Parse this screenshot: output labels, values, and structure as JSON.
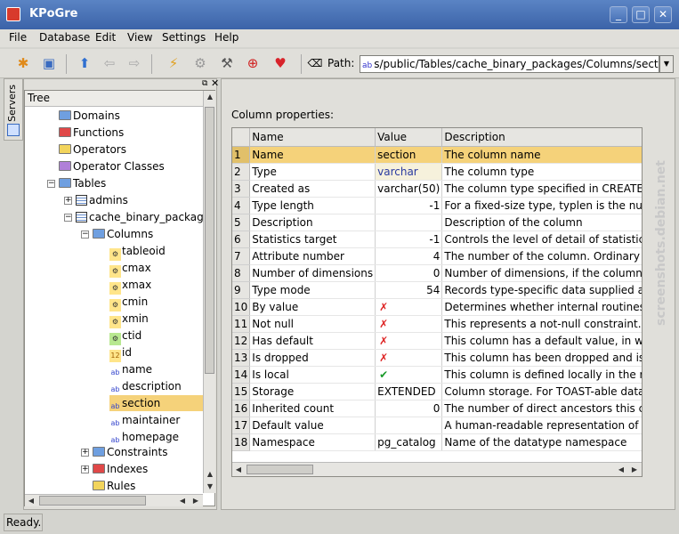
{
  "window": {
    "title": "KPoGre"
  },
  "menu": [
    "File",
    "Database",
    "Edit",
    "View",
    "Settings",
    "Help"
  ],
  "toolbar": {
    "path_label": "Path:",
    "path_value": "s/public/Tables/cache_binary_packages/Columns/section"
  },
  "sidebar_tab": "Servers",
  "tree": {
    "header": "Tree",
    "items": [
      {
        "label": "Domains"
      },
      {
        "label": "Functions"
      },
      {
        "label": "Operators"
      },
      {
        "label": "Operator Classes"
      },
      {
        "label": "Tables"
      },
      {
        "label": "admins"
      },
      {
        "label": "cache_binary_package"
      },
      {
        "label": "Columns"
      },
      {
        "label": "tableoid"
      },
      {
        "label": "cmax"
      },
      {
        "label": "xmax"
      },
      {
        "label": "cmin"
      },
      {
        "label": "xmin"
      },
      {
        "label": "ctid"
      },
      {
        "label": "id"
      },
      {
        "label": "name"
      },
      {
        "label": "description"
      },
      {
        "label": "section"
      },
      {
        "label": "maintainer"
      },
      {
        "label": "homepage"
      },
      {
        "label": "Constraints"
      },
      {
        "label": "Indexes"
      },
      {
        "label": "Rules"
      }
    ]
  },
  "main": {
    "section_label": "Column properties:",
    "columns": [
      "Name",
      "Value",
      "Description"
    ],
    "rows": [
      {
        "n": "1",
        "name": "Name",
        "value": "section",
        "desc": "The column name"
      },
      {
        "n": "2",
        "name": "Type",
        "value": "varchar",
        "desc": "The column type"
      },
      {
        "n": "3",
        "name": "Created as",
        "value": "varchar(50)",
        "desc": "The column type specified in CREATE TABLE"
      },
      {
        "n": "4",
        "name": "Type length",
        "value": "-1",
        "desc": "For a fixed-size type, typlen is the number"
      },
      {
        "n": "5",
        "name": "Description",
        "value": "",
        "desc": "Description of the column"
      },
      {
        "n": "6",
        "name": "Statistics target",
        "value": "-1",
        "desc": "Controls the level of detail of statistics ac"
      },
      {
        "n": "7",
        "name": "Attribute number",
        "value": "4",
        "desc": "The number of the column. Ordinary colu"
      },
      {
        "n": "8",
        "name": "Number of dimensions",
        "value": "0",
        "desc": "Number of dimensions, if the column is a"
      },
      {
        "n": "9",
        "name": "Type mode",
        "value": "54",
        "desc": "Records type-specific data supplied at ty"
      },
      {
        "n": "10",
        "name": "By value",
        "value": "✗",
        "desc": "Determines whether internal routines pas"
      },
      {
        "n": "11",
        "name": "Not null",
        "value": "✗",
        "desc": "This represents a not-null constraint. It is"
      },
      {
        "n": "12",
        "name": "Has default",
        "value": "✗",
        "desc": "This column has a default value, in which"
      },
      {
        "n": "13",
        "name": "Is dropped",
        "value": "✗",
        "desc": "This column has been dropped and is no"
      },
      {
        "n": "14",
        "name": "Is local",
        "value": "✔",
        "desc": "This column is defined locally in the relat"
      },
      {
        "n": "15",
        "name": "Storage",
        "value": "EXTENDED",
        "desc": "Column storage. For TOAST-able data ty"
      },
      {
        "n": "16",
        "name": "Inherited count",
        "value": "0",
        "desc": "The number of direct ancestors this colum"
      },
      {
        "n": "17",
        "name": "Default value",
        "value": "",
        "desc": "A human-readable representation of the c"
      },
      {
        "n": "18",
        "name": "Namespace",
        "value": "pg_catalog",
        "desc": "Name of the datatype namespace"
      }
    ]
  },
  "status": "Ready.",
  "watermark": "screenshots.debian.net"
}
